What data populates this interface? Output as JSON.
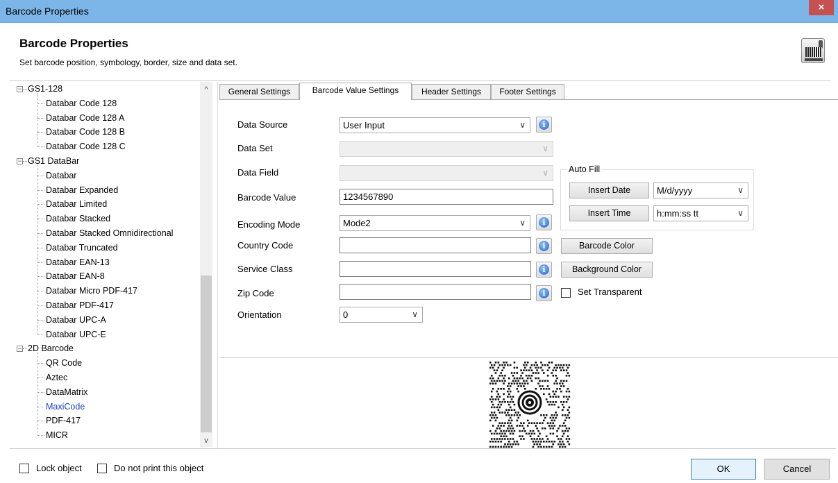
{
  "window": {
    "title": "Barcode Properties",
    "close_glyph": "×"
  },
  "header": {
    "title": "Barcode Properties",
    "subtitle": "Set barcode position, symbology, border, size and data set.",
    "logo_icon": "barcode-scanner-icon"
  },
  "tree": {
    "groups": [
      {
        "label": "GS1-128",
        "expander": "−",
        "items": [
          "Databar Code 128",
          "Databar Code 128 A",
          "Databar Code 128 B",
          "Databar Code 128 C"
        ]
      },
      {
        "label": "GS1 DataBar",
        "expander": "−",
        "items": [
          "Databar",
          "Databar Expanded",
          "Databar Limited",
          "Databar Stacked",
          "Databar Stacked Omnidirectional",
          "Databar Truncated",
          "Databar EAN-13",
          "Databar EAN-8",
          "Databar Micro PDF-417",
          "Databar PDF-417",
          "Databar UPC-A",
          "Databar UPC-E"
        ]
      },
      {
        "label": "2D Barcode",
        "expander": "−",
        "items": [
          "QR Code",
          "Aztec",
          "DataMatrix",
          "MaxiCode",
          "PDF-417",
          "MICR"
        ]
      }
    ],
    "selected": "MaxiCode",
    "scroll_up": "^",
    "scroll_down": "v"
  },
  "tabs": [
    {
      "label": "General Settings",
      "active": false
    },
    {
      "label": "Barcode Value Settings",
      "active": true
    },
    {
      "label": "Header Settings",
      "active": false
    },
    {
      "label": "Footer Settings",
      "active": false
    }
  ],
  "form": {
    "data_source": {
      "label": "Data Source",
      "value": "User Input"
    },
    "data_set": {
      "label": "Data Set",
      "value": ""
    },
    "data_field": {
      "label": "Data Field",
      "value": ""
    },
    "barcode_value": {
      "label": "Barcode Value",
      "value": "1234567890"
    },
    "encoding_mode": {
      "label": "Encoding Mode",
      "value": "Mode2"
    },
    "country_code": {
      "label": "Country Code",
      "value": ""
    },
    "service_class": {
      "label": "Service Class",
      "value": ""
    },
    "zip_code": {
      "label": "Zip Code",
      "value": ""
    },
    "orientation": {
      "label": "Orientation",
      "value": "0"
    },
    "info_glyph": "i",
    "dropdown_arrow": "∨"
  },
  "auto_fill": {
    "title": "Auto Fill",
    "insert_date_label": "Insert Date",
    "date_format": "M/d/yyyy",
    "insert_time_label": "Insert Time",
    "time_format": "h:mm:ss tt"
  },
  "color_buttons": {
    "barcode_color": "Barcode Color",
    "background_color": "Background Color",
    "set_transparent": "Set Transparent"
  },
  "footer": {
    "lock_object": "Lock object",
    "do_not_print": "Do not print this object",
    "ok": "OK",
    "cancel": "Cancel"
  },
  "colors": {
    "titlebar": "#7cb6e8",
    "close_button": "#c75050",
    "selected_tree_item": "#1c3fbf"
  }
}
